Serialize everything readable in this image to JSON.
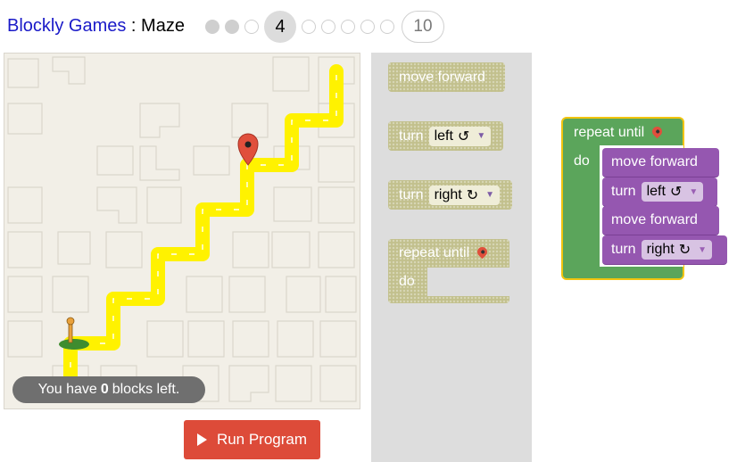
{
  "header": {
    "app_link": "Blockly Games",
    "separator": " : ",
    "game_name": "Maze",
    "levels": {
      "current": "4",
      "last": "10",
      "completed_count": 3,
      "total": 10
    }
  },
  "maze": {
    "status": {
      "prefix": "You have",
      "count": "0",
      "suffix": "blocks left."
    }
  },
  "run_button": {
    "label": "Run Program"
  },
  "toolbox": {
    "move_forward": "move forward",
    "turn_left": {
      "label": "turn",
      "value": "left",
      "symbol": "↺"
    },
    "turn_right": {
      "label": "turn",
      "value": "right",
      "symbol": "↻"
    },
    "repeat": {
      "label": "repeat until",
      "do": "do"
    }
  },
  "workspace": {
    "repeat_label": "repeat until",
    "do_label": "do",
    "statements": [
      {
        "text": "move forward"
      },
      {
        "text": "turn",
        "dropdown": "left",
        "symbol": "↺"
      },
      {
        "text": "move forward"
      },
      {
        "text": "turn",
        "dropdown": "right",
        "symbol": "↻"
      }
    ]
  },
  "colors": {
    "link": "#1a1ac8",
    "path": "#fff200",
    "run_button": "#dd4b39",
    "loop_block": "#5ba55b",
    "movement_block": "#9557b0",
    "toolbox_block": "#c2c08d",
    "highlight": "#f1c40f"
  }
}
